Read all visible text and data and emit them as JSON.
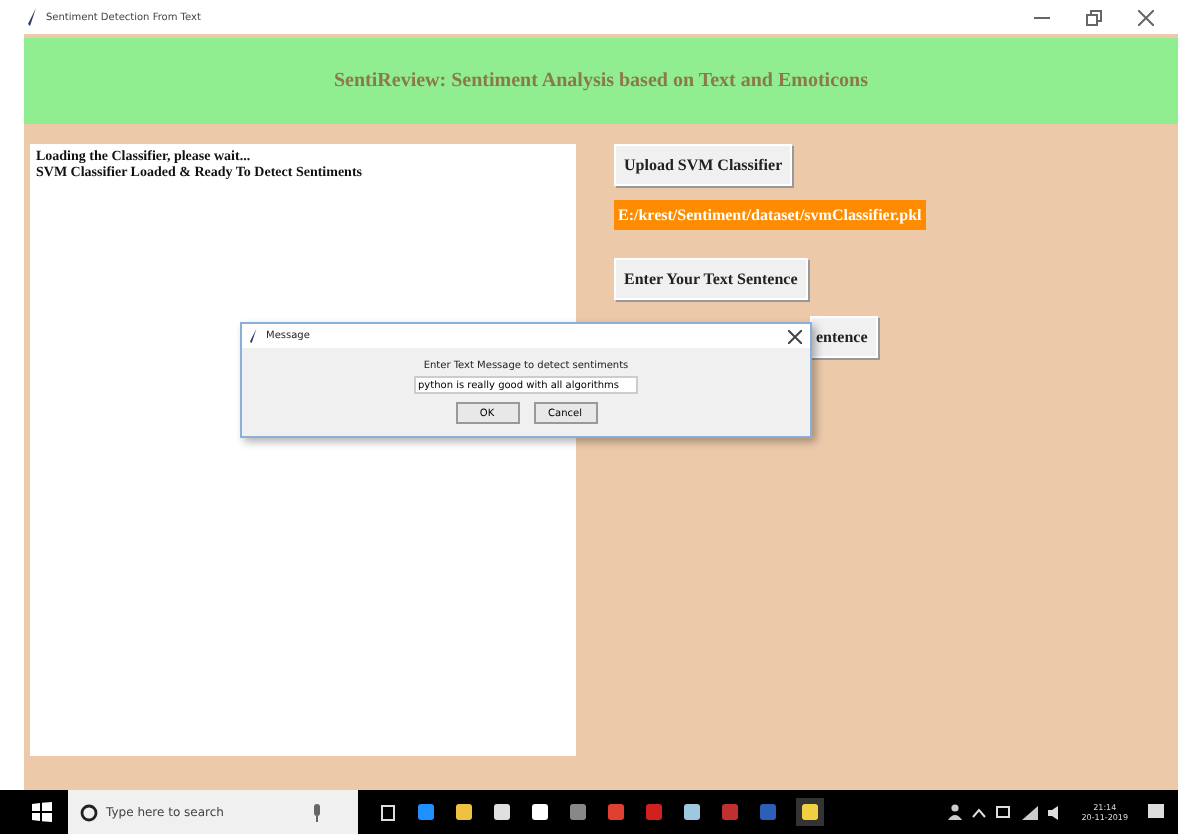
{
  "window": {
    "title": "Sentiment Detection From Text"
  },
  "header": {
    "title": "SentiReview: Sentiment Analysis based on Text and Emoticons"
  },
  "log": {
    "lines": [
      "Loading the Classifier, please wait...",
      "SVM Classifier Loaded & Ready To Detect Sentiments"
    ]
  },
  "buttons": [
    {
      "kind": "button",
      "label": "Upload SVM Classifier"
    },
    {
      "kind": "path",
      "label": "E:/krest/Sentiment/dataset/svmClassifier.pkl"
    },
    {
      "kind": "button",
      "label": "Enter Your Text Sentence"
    },
    {
      "kind": "covered",
      "label": "entence"
    }
  ],
  "dialog": {
    "title": "Message",
    "prompt": "Enter Text Message to detect sentiments",
    "value": "python is really good with all algorithms",
    "buttons": [
      "OK",
      "Cancel"
    ]
  },
  "taskbar": {
    "search": {
      "placeholder": "Type here to search"
    },
    "time": "21:14",
    "date": "20-11-2019"
  }
}
